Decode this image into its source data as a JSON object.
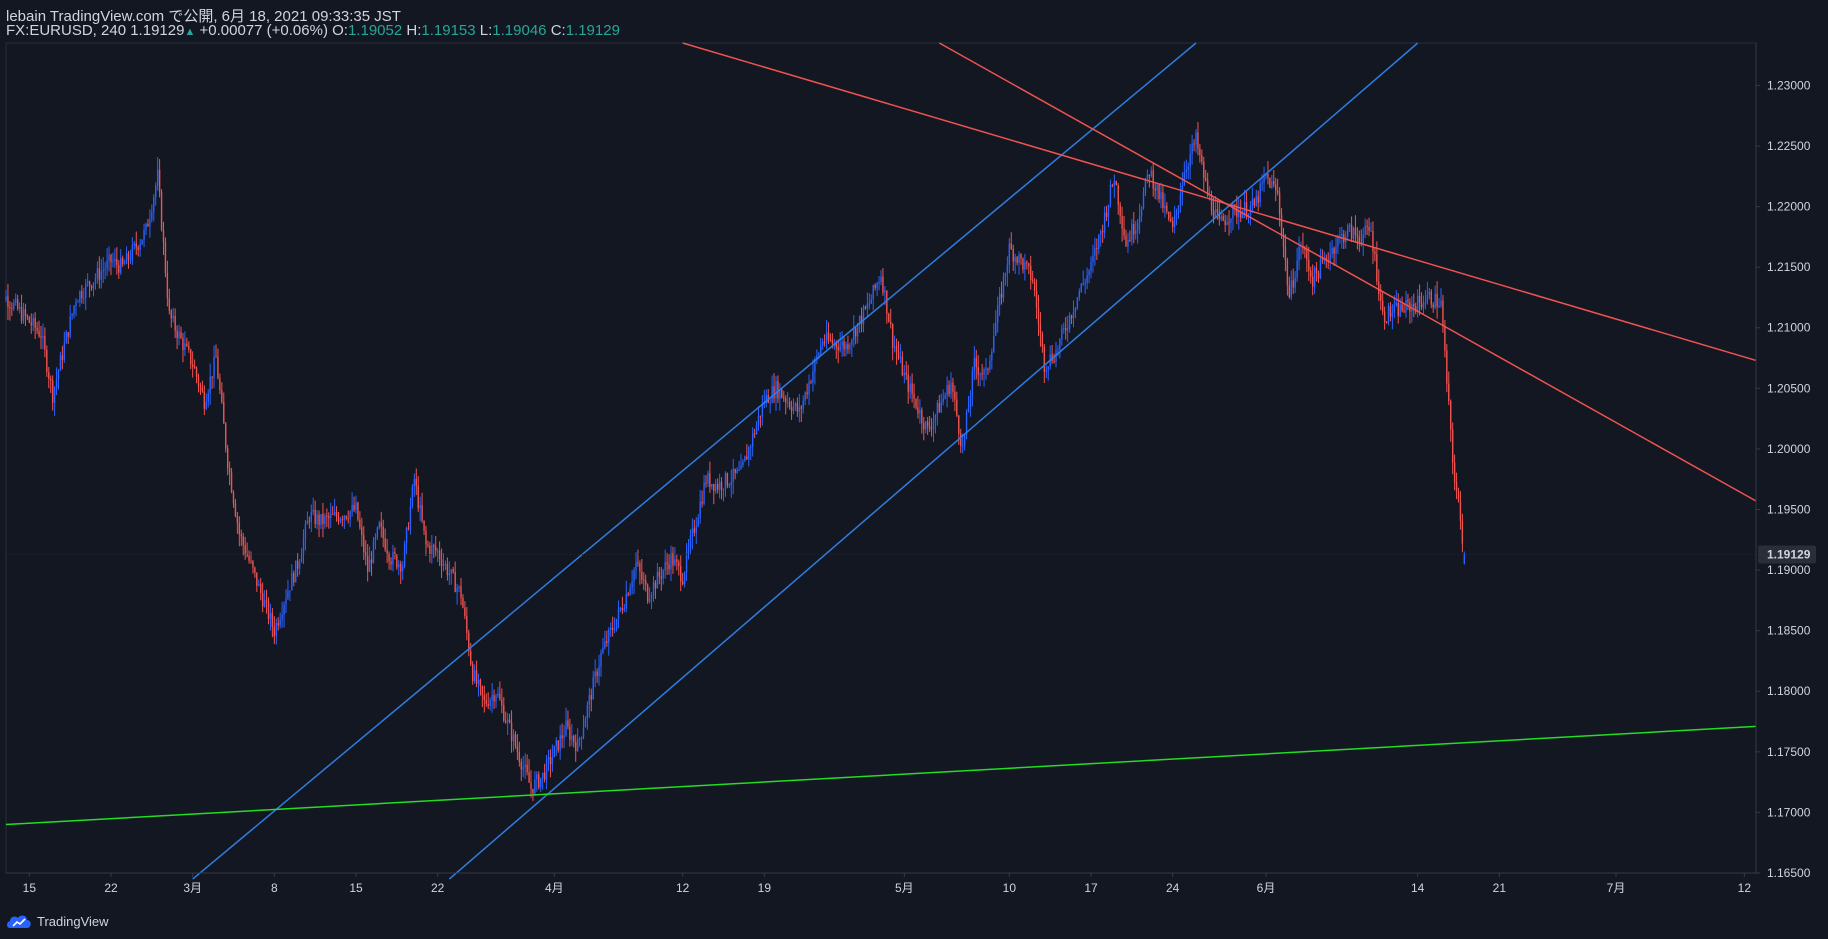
{
  "header": {
    "line1": "lebain TradingView.com で公開, 6月 18, 2021 09:33:35 JST",
    "symbol": "FX:EURUSD, 240",
    "last": "1.19129",
    "change": "+0.00077 (+0.06%)",
    "o_label": "O:",
    "o": "1.19052",
    "h_label": "H:",
    "h": "1.19153",
    "l_label": "L:",
    "l": "1.19046",
    "c_label": "C:",
    "c": "1.19129"
  },
  "footer": {
    "brand": "TradingView",
    "logo_icon": "tradingview-cloud-icon"
  },
  "colors": {
    "background": "#131722",
    "up": "#2962ff",
    "down": "#ef5350",
    "channel_up": "#2f7de1",
    "channel_down": "#ef5350",
    "support": "#22dd22",
    "text": "#d1d4dc"
  },
  "chart_data": {
    "type": "candlestick",
    "symbol": "FX:EURUSD",
    "interval": "240",
    "ylim": [
      1.165,
      1.2335
    ],
    "y_ticks": [
      "1.16500",
      "1.17000",
      "1.17500",
      "1.18000",
      "1.18500",
      "1.19000",
      "1.19500",
      "1.20000",
      "1.20500",
      "1.21000",
      "1.21500",
      "1.22000",
      "1.22500",
      "1.23000"
    ],
    "x_ticks": [
      "15",
      "22",
      "3月",
      "8",
      "15",
      "22",
      "4月",
      "12",
      "19",
      "5月",
      "10",
      "17",
      "24",
      "6月",
      "14",
      "21",
      "7月",
      "12"
    ],
    "x_tick_dates": [
      "2021-02-15",
      "2021-02-22",
      "2021-03-01",
      "2021-03-08",
      "2021-03-15",
      "2021-03-22",
      "2021-04-01",
      "2021-04-12",
      "2021-04-19",
      "2021-05-01",
      "2021-05-10",
      "2021-05-17",
      "2021-05-24",
      "2021-06-01",
      "2021-06-14",
      "2021-06-21",
      "2021-07-01",
      "2021-07-12"
    ],
    "x_range": [
      "2021-02-13",
      "2021-07-13"
    ],
    "last_price": "1.19129",
    "price_path": [
      [
        "2021-02-12",
        1.2135
      ],
      [
        "2021-02-16",
        1.2095
      ],
      [
        "2021-02-17",
        1.2045
      ],
      [
        "2021-02-18",
        1.2085
      ],
      [
        "2021-02-19",
        1.2125
      ],
      [
        "2021-02-22",
        1.2155
      ],
      [
        "2021-02-23",
        1.215
      ],
      [
        "2021-02-25",
        1.218
      ],
      [
        "2021-02-26",
        1.2225
      ],
      [
        "2021-02-27",
        1.211
      ],
      [
        "2021-03-01",
        1.207
      ],
      [
        "2021-03-02",
        1.204
      ],
      [
        "2021-03-03",
        1.2075
      ],
      [
        "2021-03-04",
        1.199
      ],
      [
        "2021-03-05",
        1.193
      ],
      [
        "2021-03-08",
        1.185
      ],
      [
        "2021-03-09",
        1.188
      ],
      [
        "2021-03-10",
        1.1905
      ],
      [
        "2021-03-11",
        1.1945
      ],
      [
        "2021-03-12",
        1.194
      ],
      [
        "2021-03-15",
        1.195
      ],
      [
        "2021-03-16",
        1.19
      ],
      [
        "2021-03-17",
        1.1935
      ],
      [
        "2021-03-18",
        1.191
      ],
      [
        "2021-03-19",
        1.1905
      ],
      [
        "2021-03-20",
        1.1975
      ],
      [
        "2021-03-21",
        1.192
      ],
      [
        "2021-03-22",
        1.1915
      ],
      [
        "2021-03-24",
        1.188
      ],
      [
        "2021-03-25",
        1.1815
      ],
      [
        "2021-03-26",
        1.179
      ],
      [
        "2021-03-27",
        1.18
      ],
      [
        "2021-03-30",
        1.172
      ],
      [
        "2021-03-31",
        1.173
      ],
      [
        "2021-04-01",
        1.175
      ],
      [
        "2021-04-02",
        1.177
      ],
      [
        "2021-04-03",
        1.1755
      ],
      [
        "2021-04-05",
        1.183
      ],
      [
        "2021-04-07",
        1.1875
      ],
      [
        "2021-04-08",
        1.1905
      ],
      [
        "2021-04-09",
        1.188
      ],
      [
        "2021-04-11",
        1.191
      ],
      [
        "2021-04-12",
        1.1895
      ],
      [
        "2021-04-14",
        1.1975
      ],
      [
        "2021-04-15",
        1.197
      ],
      [
        "2021-04-17",
        1.198
      ],
      [
        "2021-04-19",
        1.204
      ],
      [
        "2021-04-20",
        1.205
      ],
      [
        "2021-04-22",
        1.203
      ],
      [
        "2021-04-24",
        1.209
      ],
      [
        "2021-04-26",
        1.2085
      ],
      [
        "2021-04-28",
        1.212
      ],
      [
        "2021-04-29",
        1.2145
      ],
      [
        "2021-04-30",
        1.209
      ],
      [
        "2021-05-01",
        1.206
      ],
      [
        "2021-05-03",
        1.2015
      ],
      [
        "2021-05-05",
        1.2055
      ],
      [
        "2021-05-06",
        1.2
      ],
      [
        "2021-05-07",
        1.207
      ],
      [
        "2021-05-08",
        1.206
      ],
      [
        "2021-05-10",
        1.2165
      ],
      [
        "2021-05-11",
        1.2155
      ],
      [
        "2021-05-12",
        1.214
      ],
      [
        "2021-05-13",
        1.207
      ],
      [
        "2021-05-14",
        1.208
      ],
      [
        "2021-05-16",
        1.213
      ],
      [
        "2021-05-17",
        1.215
      ],
      [
        "2021-05-18",
        1.2185
      ],
      [
        "2021-05-19",
        1.2225
      ],
      [
        "2021-05-20",
        1.217
      ],
      [
        "2021-05-21",
        1.219
      ],
      [
        "2021-05-22",
        1.223
      ],
      [
        "2021-05-24",
        1.218
      ],
      [
        "2021-05-25",
        1.223
      ],
      [
        "2021-05-26",
        1.2255
      ],
      [
        "2021-05-27",
        1.221
      ],
      [
        "2021-05-28",
        1.2185
      ],
      [
        "2021-05-29",
        1.2195
      ],
      [
        "2021-05-31",
        1.22
      ],
      [
        "2021-06-01",
        1.2225
      ],
      [
        "2021-06-02",
        1.221
      ],
      [
        "2021-06-03",
        1.2125
      ],
      [
        "2021-06-04",
        1.217
      ],
      [
        "2021-06-05",
        1.214
      ],
      [
        "2021-06-07",
        1.217
      ],
      [
        "2021-06-08",
        1.218
      ],
      [
        "2021-06-09",
        1.2175
      ],
      [
        "2021-06-10",
        1.218
      ],
      [
        "2021-06-11",
        1.211
      ],
      [
        "2021-06-14",
        1.212
      ],
      [
        "2021-06-15",
        1.2125
      ],
      [
        "2021-06-16",
        1.212
      ],
      [
        "2021-06-17",
        1.199
      ],
      [
        "2021-06-18",
        1.1913
      ]
    ],
    "trend_lines": [
      {
        "name": "ascending-channel-upper",
        "color": "#2f7de1",
        "p1": [
          "2021-03-01",
          1.1645
        ],
        "p2": [
          "2021-05-26",
          1.2335
        ]
      },
      {
        "name": "ascending-channel-lower",
        "color": "#2f7de1",
        "p1": [
          "2021-03-23",
          1.1645
        ],
        "p2": [
          "2021-06-14",
          1.2335
        ]
      },
      {
        "name": "descending-channel-upper",
        "color": "#ef5350",
        "p1": [
          "2021-04-12",
          1.2335
        ],
        "p2": [
          "2021-07-13",
          1.2073
        ]
      },
      {
        "name": "descending-channel-lower",
        "color": "#ef5350",
        "p1": [
          "2021-05-04",
          1.2335
        ],
        "p2": [
          "2021-07-13",
          1.1957
        ]
      },
      {
        "name": "long-term-support",
        "color": "#22dd22",
        "p1": [
          "2021-02-13",
          1.169
        ],
        "p2": [
          "2021-07-13",
          1.1771
        ]
      }
    ]
  }
}
